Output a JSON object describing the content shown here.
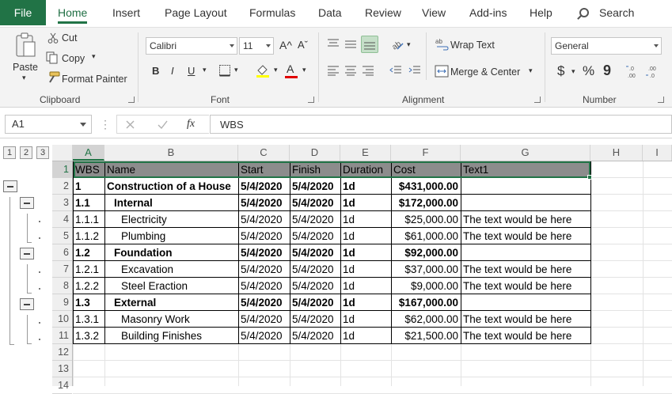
{
  "tabs": {
    "file": "File",
    "home": "Home",
    "insert": "Insert",
    "page_layout": "Page Layout",
    "formulas": "Formulas",
    "data": "Data",
    "review": "Review",
    "view": "View",
    "addins": "Add-ins",
    "help": "Help",
    "search": "Search"
  },
  "ribbon": {
    "clipboard": {
      "paste": "Paste",
      "cut": "Cut",
      "copy": "Copy",
      "format_painter": "Format Painter",
      "label": "Clipboard"
    },
    "font": {
      "name": "Calibri",
      "size": "11",
      "grow": "A^",
      "shrink": "Aˇ",
      "bold": "B",
      "italic": "I",
      "underline": "U",
      "font_color_letter": "A",
      "label": "Font"
    },
    "alignment": {
      "wrap_text": "Wrap Text",
      "merge_center": "Merge & Center",
      "label": "Alignment"
    },
    "number": {
      "format": "General",
      "currency": "$",
      "percent": "%",
      "comma": "9",
      "label": "Number"
    }
  },
  "formula_bar": {
    "name_box": "A1",
    "fx": "fx",
    "content": "WBS"
  },
  "sheet": {
    "outline_levels": [
      "1",
      "2",
      "3"
    ],
    "columns": [
      "A",
      "B",
      "C",
      "D",
      "E",
      "F",
      "G",
      "H",
      "I"
    ],
    "row_numbers": [
      "1",
      "2",
      "3",
      "4",
      "5",
      "6",
      "7",
      "8",
      "9",
      "10",
      "11",
      "12",
      "13",
      "14"
    ],
    "header": [
      "WBS",
      "Name",
      "Start",
      "Finish",
      "Duration",
      "Cost",
      "Text1"
    ],
    "rows": [
      {
        "wbs": "1",
        "name": "Construction of a House",
        "start": "5/4/2020",
        "finish": "5/4/2020",
        "duration": "1d",
        "cost": "$431,000.00",
        "text1": "",
        "bold": true,
        "indent": 0
      },
      {
        "wbs": "1.1",
        "name": "Internal",
        "start": "5/4/2020",
        "finish": "5/4/2020",
        "duration": "1d",
        "cost": "$172,000.00",
        "text1": "",
        "bold": true,
        "indent": 1
      },
      {
        "wbs": "1.1.1",
        "name": "Electricity",
        "start": "5/4/2020",
        "finish": "5/4/2020",
        "duration": "1d",
        "cost": "$25,000.00",
        "text1": "The text would be here",
        "bold": false,
        "indent": 2
      },
      {
        "wbs": "1.1.2",
        "name": "Plumbing",
        "start": "5/4/2020",
        "finish": "5/4/2020",
        "duration": "1d",
        "cost": "$61,000.00",
        "text1": "The text would be here",
        "bold": false,
        "indent": 2
      },
      {
        "wbs": "1.2",
        "name": "Foundation",
        "start": "5/4/2020",
        "finish": "5/4/2020",
        "duration": "1d",
        "cost": "$92,000.00",
        "text1": "",
        "bold": true,
        "indent": 1
      },
      {
        "wbs": "1.2.1",
        "name": "Excavation",
        "start": "5/4/2020",
        "finish": "5/4/2020",
        "duration": "1d",
        "cost": "$37,000.00",
        "text1": "The text would be here",
        "bold": false,
        "indent": 2
      },
      {
        "wbs": "1.2.2",
        "name": "Steel Eraction",
        "start": "5/4/2020",
        "finish": "5/4/2020",
        "duration": "1d",
        "cost": "$9,000.00",
        "text1": "The text would be here",
        "bold": false,
        "indent": 2
      },
      {
        "wbs": "1.3",
        "name": "External",
        "start": "5/4/2020",
        "finish": "5/4/2020",
        "duration": "1d",
        "cost": "$167,000.00",
        "text1": "",
        "bold": true,
        "indent": 1
      },
      {
        "wbs": "1.3.1",
        "name": "Masonry Work",
        "start": "5/4/2020",
        "finish": "5/4/2020",
        "duration": "1d",
        "cost": "$62,000.00",
        "text1": "The text would be here",
        "bold": false,
        "indent": 2
      },
      {
        "wbs": "1.3.2",
        "name": "Building Finishes",
        "start": "5/4/2020",
        "finish": "5/4/2020",
        "duration": "1d",
        "cost": "$21,500.00",
        "text1": "The text would be here",
        "bold": false,
        "indent": 2
      }
    ]
  },
  "colors": {
    "accent": "#217346",
    "header_fill": "#8c8c8c",
    "ribbon_bg": "#f3f3f3"
  }
}
